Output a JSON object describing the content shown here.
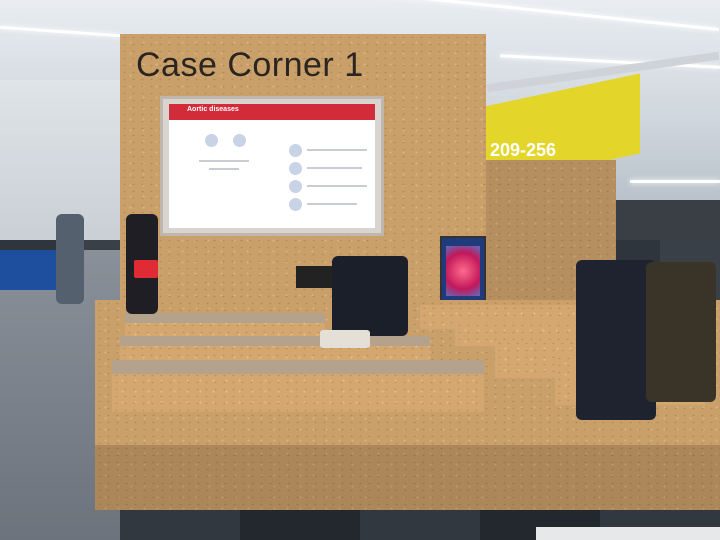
{
  "signage": {
    "booth_title": "Case Corner 1",
    "number_sign": "209-256",
    "screen_heading": "Aortic diseases"
  },
  "colors": {
    "osb_wood": "#c99f6a",
    "sign_yellow": "#e4d52b",
    "screen_red": "#d22b3a",
    "folder_red": "#e02a34"
  }
}
